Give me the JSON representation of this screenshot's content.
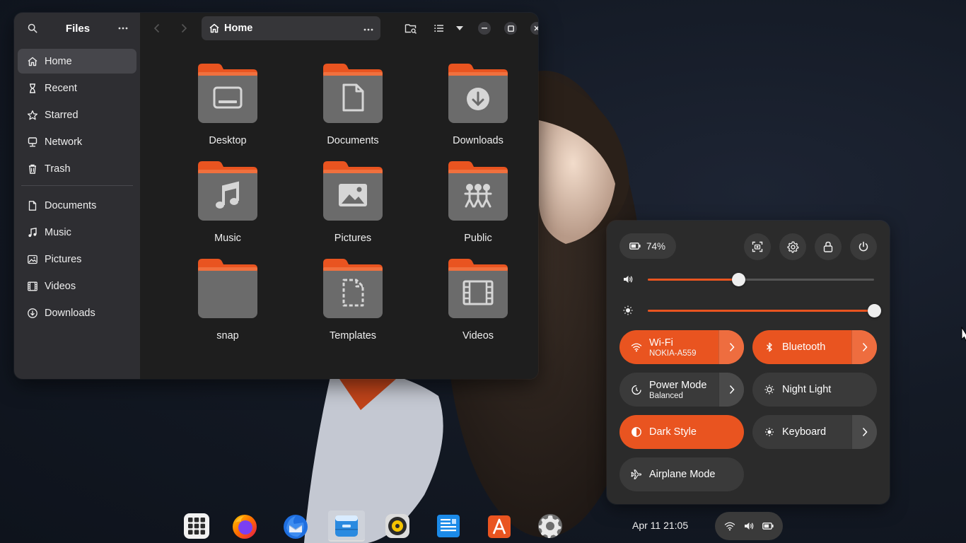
{
  "files": {
    "sidebar_title": "Files",
    "sidebar_items": [
      {
        "label": "Home",
        "icon": "home-icon"
      },
      {
        "label": "Recent",
        "icon": "hourglass-icon"
      },
      {
        "label": "Starred",
        "icon": "star-icon"
      },
      {
        "label": "Network",
        "icon": "network-icon"
      },
      {
        "label": "Trash",
        "icon": "trash-icon"
      }
    ],
    "bookmarks": [
      {
        "label": "Documents",
        "icon": "document-icon"
      },
      {
        "label": "Music",
        "icon": "music-icon"
      },
      {
        "label": "Pictures",
        "icon": "picture-icon"
      },
      {
        "label": "Videos",
        "icon": "film-icon"
      },
      {
        "label": "Downloads",
        "icon": "download-icon"
      }
    ],
    "path": "Home",
    "folders": [
      {
        "label": "Desktop",
        "icon": "desktop-icon"
      },
      {
        "label": "Documents",
        "icon": "document-icon"
      },
      {
        "label": "Downloads",
        "icon": "download-icon"
      },
      {
        "label": "Music",
        "icon": "music-icon"
      },
      {
        "label": "Pictures",
        "icon": "picture-icon"
      },
      {
        "label": "Public",
        "icon": "people-icon"
      },
      {
        "label": "snap",
        "icon": "folder-icon"
      },
      {
        "label": "Templates",
        "icon": "template-icon"
      },
      {
        "label": "Videos",
        "icon": "film-icon"
      }
    ]
  },
  "quick_settings": {
    "battery": "74%",
    "volume_level": 0.4,
    "brightness_level": 1.0,
    "toggles": [
      {
        "title": "Wi-Fi",
        "subtitle": "NOKIA-A559",
        "on": true,
        "arrow": true,
        "icon": "wifi-icon"
      },
      {
        "title": "Bluetooth",
        "subtitle": "",
        "on": true,
        "arrow": true,
        "icon": "bluetooth-icon"
      },
      {
        "title": "Power Mode",
        "subtitle": "Balanced",
        "on": false,
        "arrow": true,
        "icon": "power-mode-icon"
      },
      {
        "title": "Night Light",
        "subtitle": "",
        "on": false,
        "arrow": false,
        "icon": "night-light-icon"
      },
      {
        "title": "Dark Style",
        "subtitle": "",
        "on": true,
        "arrow": false,
        "icon": "dark-style-icon"
      },
      {
        "title": "Keyboard",
        "subtitle": "",
        "on": false,
        "arrow": true,
        "icon": "keyboard-brightness-icon"
      },
      {
        "title": "Airplane Mode",
        "subtitle": "",
        "on": false,
        "arrow": false,
        "icon": "airplane-icon"
      }
    ]
  },
  "dock": [
    "app-grid",
    "firefox",
    "thunderbird",
    "files",
    "rhythmbox",
    "writer",
    "app-center",
    "settings"
  ],
  "clock": "Apr 11  21:05",
  "colors": {
    "accent": "#e95420",
    "panel": "#2b2b2b",
    "folder_tab": "#e95420",
    "folder_body": "#6b6b6b"
  }
}
